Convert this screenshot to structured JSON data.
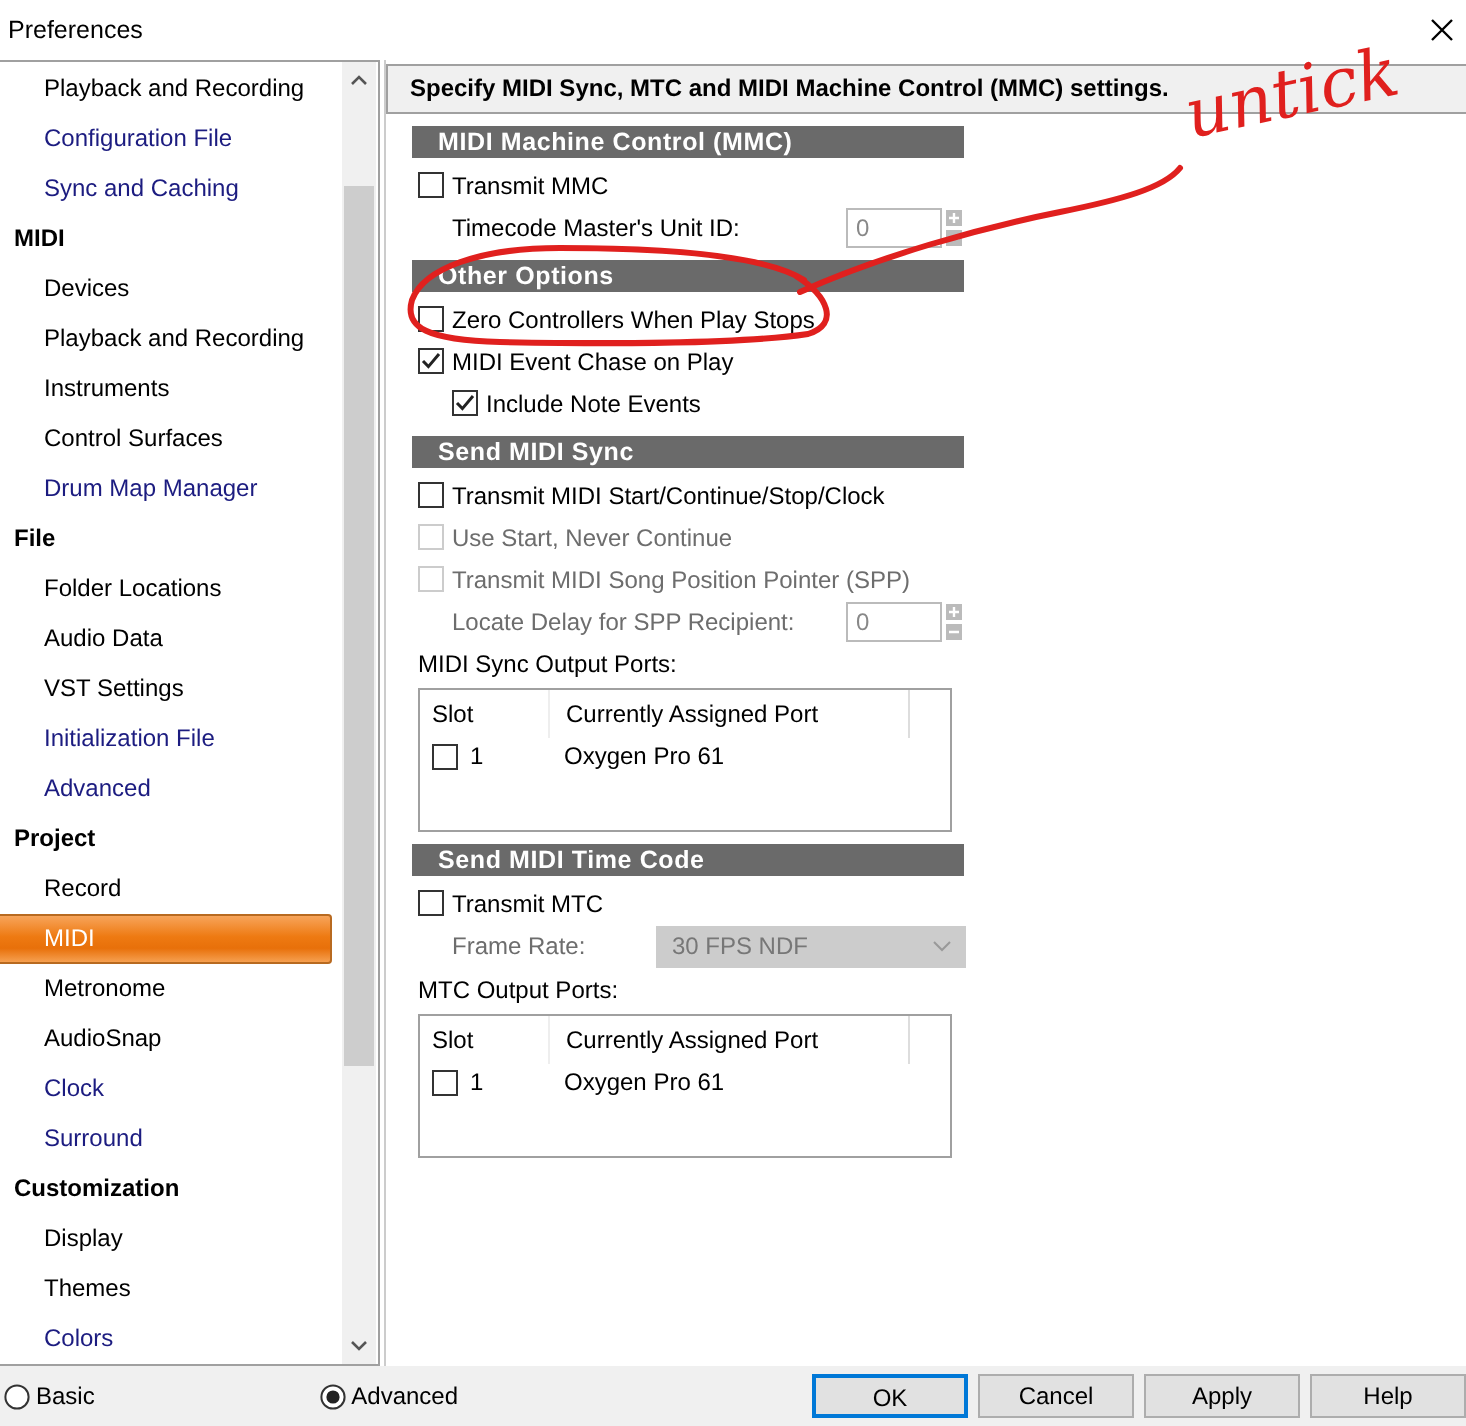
{
  "window": {
    "title": "Preferences"
  },
  "sidebar": {
    "items": [
      {
        "label": "Playback and Recording",
        "kind": "item",
        "color": "#000000",
        "selected": false
      },
      {
        "label": "Configuration File",
        "kind": "item",
        "color": "#1c1c80",
        "selected": false
      },
      {
        "label": "Sync and Caching",
        "kind": "item",
        "color": "#1c1c80",
        "selected": false
      },
      {
        "label": "MIDI",
        "kind": "header"
      },
      {
        "label": "Devices",
        "kind": "item",
        "color": "#000000",
        "selected": false
      },
      {
        "label": "Playback and Recording",
        "kind": "item",
        "color": "#000000",
        "selected": false
      },
      {
        "label": "Instruments",
        "kind": "item",
        "color": "#000000",
        "selected": false
      },
      {
        "label": "Control Surfaces",
        "kind": "item",
        "color": "#000000",
        "selected": false
      },
      {
        "label": "Drum Map Manager",
        "kind": "item",
        "color": "#1c1c80",
        "selected": false
      },
      {
        "label": "File",
        "kind": "header"
      },
      {
        "label": "Folder Locations",
        "kind": "item",
        "color": "#000000",
        "selected": false
      },
      {
        "label": "Audio Data",
        "kind": "item",
        "color": "#000000",
        "selected": false
      },
      {
        "label": "VST Settings",
        "kind": "item",
        "color": "#000000",
        "selected": false
      },
      {
        "label": "Initialization File",
        "kind": "item",
        "color": "#1c1c80",
        "selected": false
      },
      {
        "label": "Advanced",
        "kind": "item",
        "color": "#1c1c80",
        "selected": false
      },
      {
        "label": "Project",
        "kind": "header"
      },
      {
        "label": "Record",
        "kind": "item",
        "color": "#000000",
        "selected": false
      },
      {
        "label": "MIDI",
        "kind": "item",
        "selected": true
      },
      {
        "label": "Metronome",
        "kind": "item",
        "color": "#000000",
        "selected": false
      },
      {
        "label": "AudioSnap",
        "kind": "item",
        "color": "#000000",
        "selected": false
      },
      {
        "label": "Clock",
        "kind": "item",
        "color": "#1c1c80",
        "selected": false
      },
      {
        "label": "Surround",
        "kind": "item",
        "color": "#1c1c80",
        "selected": false
      },
      {
        "label": "Customization",
        "kind": "header"
      },
      {
        "label": "Display",
        "kind": "item",
        "color": "#000000",
        "selected": false
      },
      {
        "label": "Themes",
        "kind": "item",
        "color": "#000000",
        "selected": false
      },
      {
        "label": "Colors",
        "kind": "item",
        "color": "#1c1c80",
        "selected": false
      }
    ]
  },
  "panel": {
    "heading": "Specify MIDI Sync, MTC and MIDI Machine Control (MMC) settings.",
    "sections": [
      {
        "title": "MIDI Machine Control (MMC)",
        "controls": [
          {
            "kind": "checkbox",
            "label": "Transmit MMC",
            "checked": false,
            "disabled": false,
            "children": [
              {
                "kind": "spinner",
                "label": "Timecode Master's Unit ID:",
                "value": "0",
                "disabled": false
              }
            ]
          }
        ]
      },
      {
        "title": "Other Options",
        "controls": [
          {
            "kind": "checkbox",
            "label": "Zero Controllers When Play Stops",
            "checked": false,
            "disabled": false
          },
          {
            "kind": "checkbox",
            "label": "MIDI Event Chase on Play",
            "checked": true,
            "disabled": false,
            "children": [
              {
                "kind": "checkbox",
                "label": "Include Note Events",
                "checked": true,
                "disabled": false
              }
            ]
          }
        ]
      },
      {
        "title": "Send MIDI Sync",
        "controls": [
          {
            "kind": "checkbox",
            "label": "Transmit MIDI Start/Continue/Stop/Clock",
            "checked": false,
            "disabled": false
          },
          {
            "kind": "checkbox",
            "label": "Use Start, Never Continue",
            "checked": false,
            "disabled": true
          },
          {
            "kind": "checkbox",
            "label": "Transmit MIDI Song Position Pointer (SPP)",
            "checked": false,
            "disabled": true,
            "children": [
              {
                "kind": "spinner",
                "label": "Locate Delay for SPP Recipient:",
                "value": "0",
                "disabled": true
              }
            ]
          },
          {
            "kind": "ports",
            "label": "MIDI Sync Output Ports:",
            "columns": [
              "Slot",
              "Currently Assigned Port"
            ],
            "rows": [
              {
                "slot": "1",
                "port": "Oxygen Pro 61",
                "checked": false
              }
            ]
          }
        ]
      },
      {
        "title": "Send MIDI Time Code",
        "controls": [
          {
            "kind": "checkbox",
            "label": "Transmit MTC",
            "checked": false,
            "disabled": false,
            "children": [
              {
                "kind": "dropdown",
                "label": "Frame Rate:",
                "value": "30 FPS NDF",
                "disabled": true
              }
            ]
          },
          {
            "kind": "ports",
            "label": "MTC Output Ports:",
            "columns": [
              "Slot",
              "Currently Assigned Port"
            ],
            "rows": [
              {
                "slot": "1",
                "port": "Oxygen Pro 61",
                "checked": false
              }
            ]
          }
        ]
      }
    ]
  },
  "mode": [
    {
      "label": "Basic",
      "selected": false
    },
    {
      "label": "Advanced",
      "selected": true
    }
  ],
  "buttons": [
    {
      "label": "OK",
      "default": true
    },
    {
      "label": "Cancel",
      "default": false
    },
    {
      "label": "Apply",
      "default": false
    },
    {
      "label": "Help",
      "default": false
    }
  ],
  "annotation": {
    "text": "untick"
  }
}
